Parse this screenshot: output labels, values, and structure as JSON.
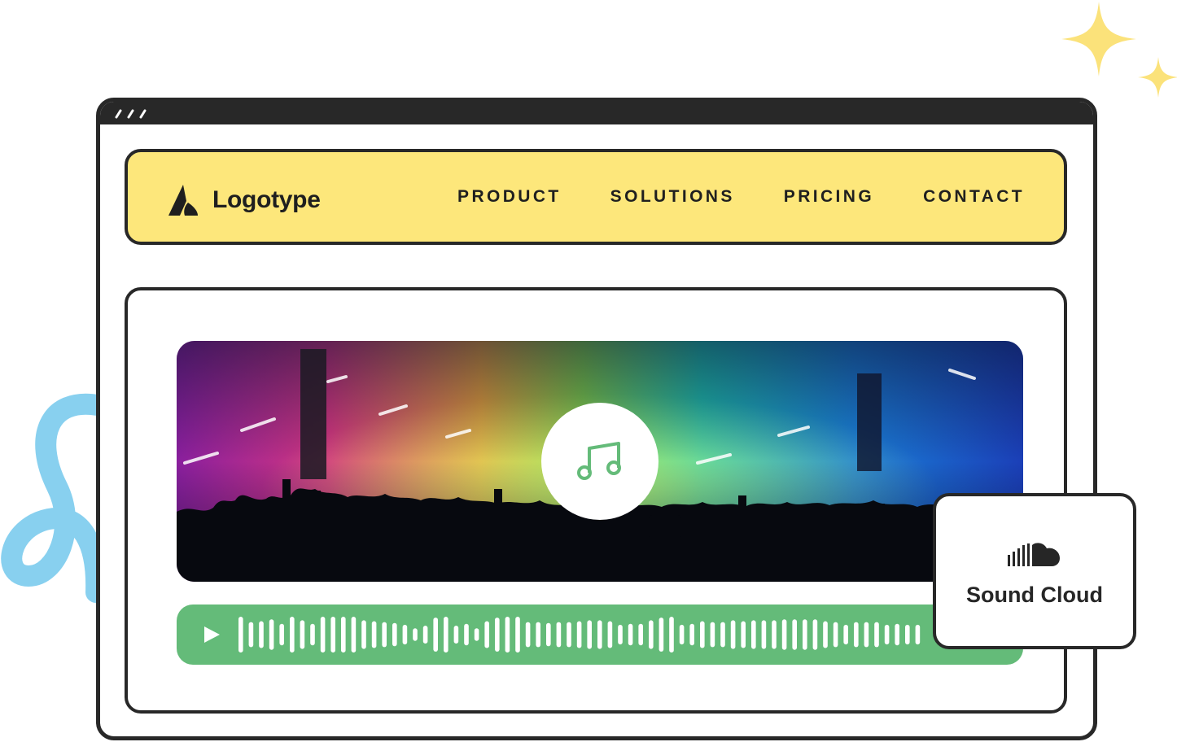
{
  "brand": {
    "name": "Logotype"
  },
  "nav": {
    "items": [
      {
        "label": "PRODUCT"
      },
      {
        "label": "SOLUTIONS"
      },
      {
        "label": "PRICING"
      },
      {
        "label": "CONTACT"
      }
    ]
  },
  "badge": {
    "label": "Sound Cloud",
    "icon": "soundcloud-icon"
  },
  "player": {
    "play_icon": "play-icon",
    "center_icon": "music-note-icon"
  },
  "colors": {
    "navbar": "#fde77b",
    "player": "#64bb79",
    "frame": "#282828",
    "sparkle": "#fbe27a",
    "squiggle": "#82cdee"
  }
}
